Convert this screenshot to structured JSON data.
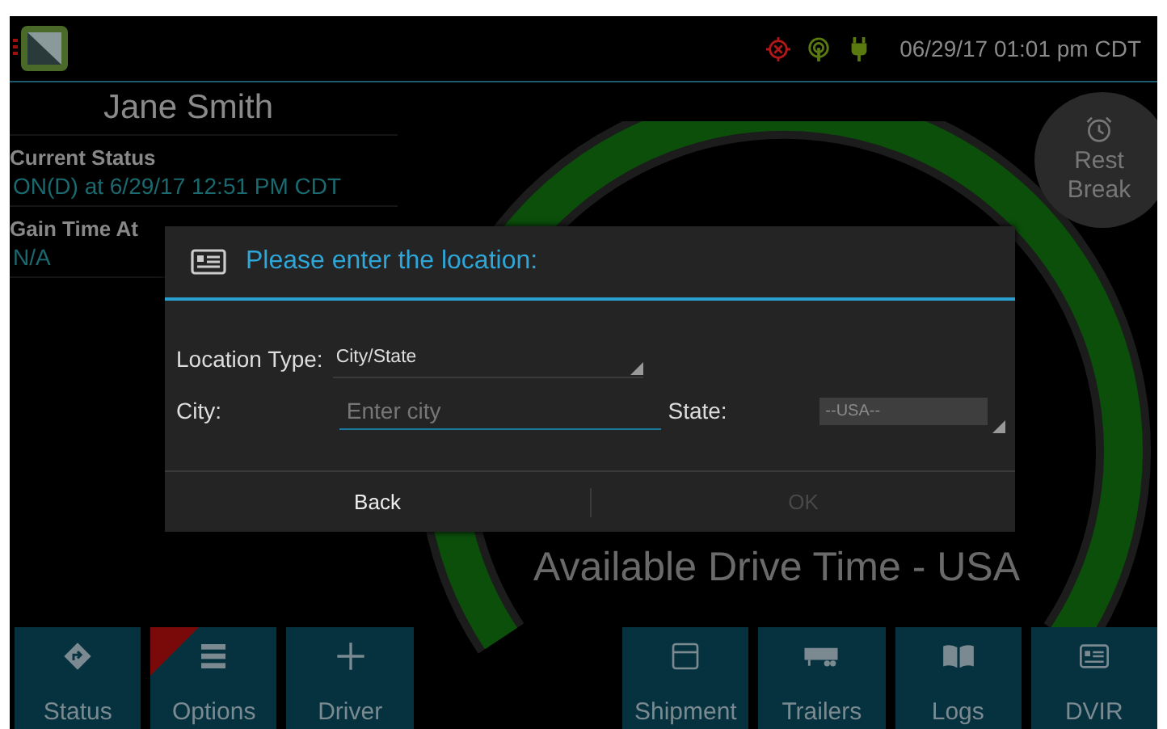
{
  "top_bar": {
    "datetime": "06/29/17 01:01 pm CDT"
  },
  "driver_name": "Jane Smith",
  "current_status": {
    "label": "Current Status",
    "value": "ON(D) at 6/29/17 12:51 PM CDT"
  },
  "gain_time": {
    "label": "Gain Time At",
    "value": "N/A"
  },
  "rest_break_button": {
    "label": "Rest Break"
  },
  "gauge": {
    "label": "Available Drive Time - USA"
  },
  "dialog": {
    "title": "Please enter the location:",
    "location_type": {
      "label": "Location Type:",
      "value": "City/State"
    },
    "city": {
      "label": "City:",
      "placeholder": "Enter city"
    },
    "state": {
      "label": "State:",
      "value": "--USA--",
      "disabled": true
    },
    "buttons": [
      {
        "label": "Back",
        "disabled": false
      },
      {
        "label": "OK",
        "disabled": true
      }
    ]
  },
  "nav": [
    {
      "kind": "status",
      "label": "Status",
      "alert": false
    },
    {
      "kind": "options",
      "label": "Options",
      "alert": true
    },
    {
      "kind": "driver",
      "label": "Driver",
      "alert": false
    },
    {
      "kind": "gap"
    },
    {
      "kind": "shipment",
      "label": "Shipment",
      "alert": false
    },
    {
      "kind": "trailers",
      "label": "Trailers",
      "alert": false
    },
    {
      "kind": "logs",
      "label": "Logs",
      "alert": false
    },
    {
      "kind": "dvir",
      "label": "DVIR",
      "alert": false
    }
  ]
}
